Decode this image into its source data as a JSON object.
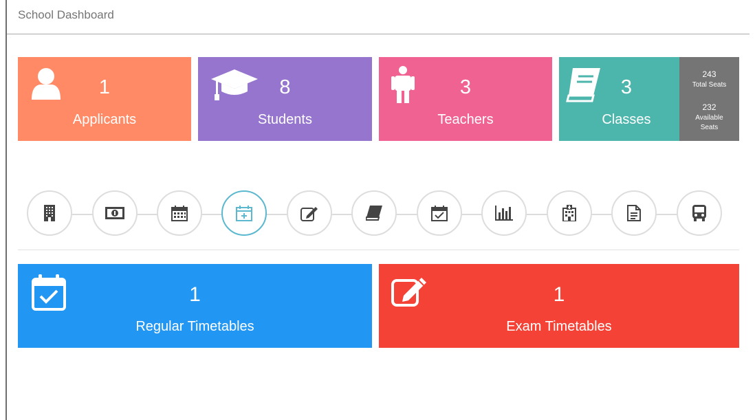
{
  "header": {
    "title": "School Dashboard"
  },
  "stats": [
    {
      "name": "applicants",
      "count": "1",
      "label": "Applicants",
      "icon": "user-icon",
      "color": "#ff8a65"
    },
    {
      "name": "students",
      "count": "8",
      "label": "Students",
      "icon": "graduation-cap-icon",
      "color": "#9575cd"
    },
    {
      "name": "teachers",
      "count": "3",
      "label": "Teachers",
      "icon": "person-icon",
      "color": "#f06292"
    },
    {
      "name": "classes",
      "count": "3",
      "label": "Classes",
      "icon": "book-icon",
      "color": "#4db6ac",
      "seats": {
        "total": "243",
        "total_label": "Total Seats",
        "available": "232",
        "available_label_1": "Available",
        "available_label_2": "Seats"
      }
    }
  ],
  "quick_actions": [
    {
      "icon": "building-icon"
    },
    {
      "icon": "money-icon"
    },
    {
      "icon": "calendar-icon"
    },
    {
      "icon": "calendar-plus-icon",
      "active": true
    },
    {
      "icon": "edit-icon"
    },
    {
      "icon": "book-icon"
    },
    {
      "icon": "calendar-check-icon"
    },
    {
      "icon": "bar-chart-icon"
    },
    {
      "icon": "hospital-icon"
    },
    {
      "icon": "file-text-icon"
    },
    {
      "icon": "bus-icon"
    }
  ],
  "timetables": [
    {
      "name": "regular",
      "count": "1",
      "label": "Regular Timetables",
      "icon": "calendar-check-icon",
      "color": "#2196f3"
    },
    {
      "name": "exam",
      "count": "1",
      "label": "Exam Timetables",
      "icon": "edit-icon",
      "color": "#f44336"
    }
  ],
  "colors": {
    "accent_active": "#5bb8cf",
    "icon_dark": "#444444"
  }
}
